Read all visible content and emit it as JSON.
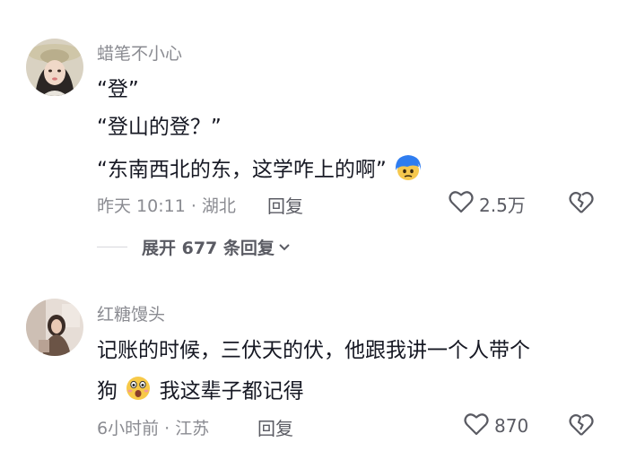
{
  "comments": [
    {
      "username": "蜡笔不小心",
      "lines": [
        "“登”",
        "“登山的登？”",
        "“东南西北的东，这学咋上的啊”"
      ],
      "time": "昨天 10:11 · 湖北",
      "reply_label": "回复",
      "likes": "2.5万",
      "expand_label": "展开 677 条回复"
    },
    {
      "username": "红糖馒头",
      "lines": [
        "记账的时候，三伏天的伏，他跟我讲一个人带个",
        "狗",
        "我这辈子都记得"
      ],
      "time": "6小时前 · 江苏",
      "reply_label": "回复",
      "likes": "870"
    }
  ],
  "colors": {
    "text": "#161823",
    "meta": "#8a8b91",
    "action": "#5a5b63"
  },
  "icons": [
    "heart-outline-icon",
    "broken-heart-icon",
    "chevron-down-icon",
    "blue-hair-face-emoji",
    "shocked-face-emoji"
  ]
}
